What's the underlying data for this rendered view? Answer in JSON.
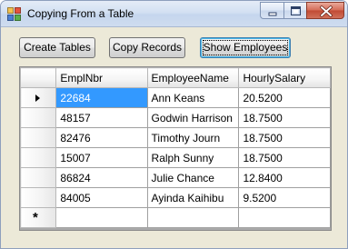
{
  "window": {
    "title": "Copying From a Table"
  },
  "toolbar": {
    "create_tables_label": "Create Tables",
    "copy_records_label": "Copy Records",
    "show_employees_label": "Show Employees"
  },
  "grid": {
    "columns": [
      "EmplNbr",
      "EmployeeName",
      "HourlySalary"
    ],
    "rows": [
      [
        "22684",
        "Ann Keans",
        "20.5200"
      ],
      [
        "48157",
        "Godwin Harrison",
        "18.7500"
      ],
      [
        "82476",
        "Timothy Journ",
        "18.7500"
      ],
      [
        "15007",
        "Ralph Sunny",
        "18.7500"
      ],
      [
        "86824",
        "Julie Chance",
        "12.8400"
      ],
      [
        "84005",
        "Ayinda Kaihibu",
        "9.5200"
      ]
    ],
    "current_row_indicator": "right-triangle-icon",
    "new_row_indicator": "asterisk-icon"
  },
  "colors": {
    "selection": "#3399ff",
    "grid_background": "#aaaaaa",
    "window_face": "#ece9d8",
    "close_button": "#c04a33"
  }
}
